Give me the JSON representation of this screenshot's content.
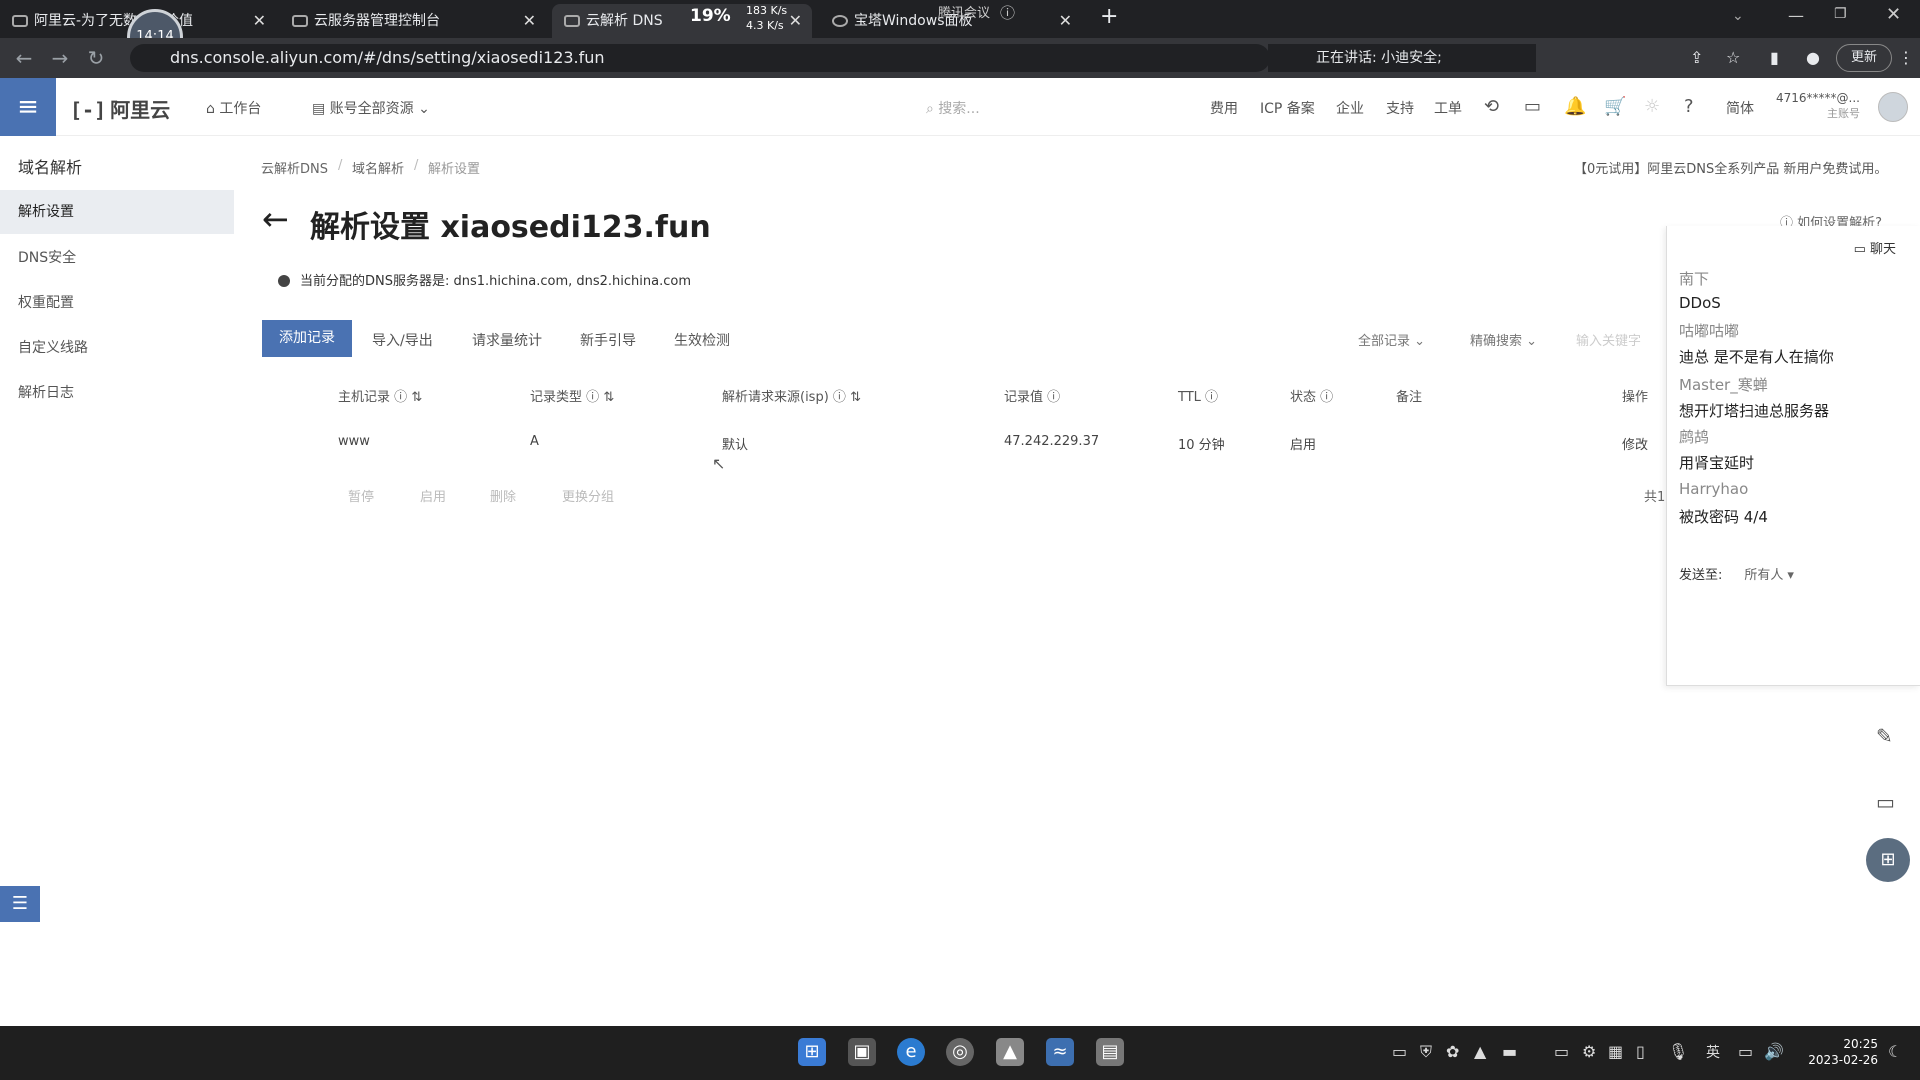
{
  "browser": {
    "tabs": [
      {
        "label": "阿里云-为了无数人的价值"
      },
      {
        "label": "云服务器管理控制台"
      },
      {
        "label": "云解析 DNS"
      },
      {
        "label": "宝塔Windows面板"
      }
    ],
    "timer_badge": "14:14",
    "net_speed": {
      "percent": "19%",
      "up": "183 K/s",
      "down": "4.3 K/s"
    },
    "meeting_label": "腾讯会议",
    "url": "dns.console.aliyun.com/#/dns/setting/xiaosedi123.fun",
    "speaking": "正在讲话: 小迪安全;",
    "update_label": "更新"
  },
  "topnav": {
    "logo": "阿里云",
    "workbench": "工作台",
    "resources": "账号全部资源",
    "search_placeholder": "搜索...",
    "links": [
      "费用",
      "ICP 备案",
      "企业",
      "支持",
      "工单"
    ],
    "lang": "简体",
    "account_id": "4716*****@...",
    "account_role": "主账号"
  },
  "sidebar": {
    "title": "域名解析",
    "items": [
      "解析设置",
      "DNS安全",
      "权重配置",
      "自定义线路",
      "解析日志"
    ]
  },
  "breadcrumb": [
    "云解析DNS",
    "域名解析",
    "解析设置"
  ],
  "promo": "【0元试用】阿里云DNS全系列产品 新用户免费试用。",
  "page": {
    "title": "解析设置 xiaosedi123.fun",
    "howto": "如何设置解析?",
    "dns_info": "当前分配的DNS服务器是: dns1.hichina.com, dns2.hichina.com"
  },
  "toolbar": {
    "add_record": "添加记录",
    "buttons": [
      "导入/导出",
      "请求量统计",
      "新手引导",
      "生效检测"
    ],
    "all_records": "全部记录",
    "precise_search": "精确搜索",
    "keyword_placeholder": "输入关键字"
  },
  "table": {
    "headers": [
      "主机记录",
      "记录类型",
      "解析请求来源(isp)",
      "记录值",
      "TTL",
      "状态",
      "备注",
      "操作"
    ],
    "rows": [
      {
        "host": "www",
        "type": "A",
        "isp": "默认",
        "value": "47.242.229.37",
        "ttl": "10 分钟",
        "status": "启用",
        "note": "",
        "action": "修改"
      }
    ],
    "batch_actions": [
      "暂停",
      "启用",
      "删除",
      "更换分组"
    ],
    "total_prefix": "共1"
  },
  "chat": {
    "header": "聊天",
    "messages": [
      {
        "name": "南下",
        "text": "DDoS"
      },
      {
        "name": "咕嘟咕嘟",
        "text": "迪总 是不是有人在搞你"
      },
      {
        "name": "Master_寒蝉",
        "text": "想开灯塔扫迪总服务器"
      },
      {
        "name": "鹧鸪",
        "text": "用肾宝延时"
      },
      {
        "name": "Harryhao",
        "text": "被改密码 4/4"
      }
    ],
    "send_to_label": "发送至:",
    "send_to_value": "所有人"
  },
  "taskbar": {
    "ime": "英",
    "time": "20:25",
    "date": "2023-02-26"
  }
}
